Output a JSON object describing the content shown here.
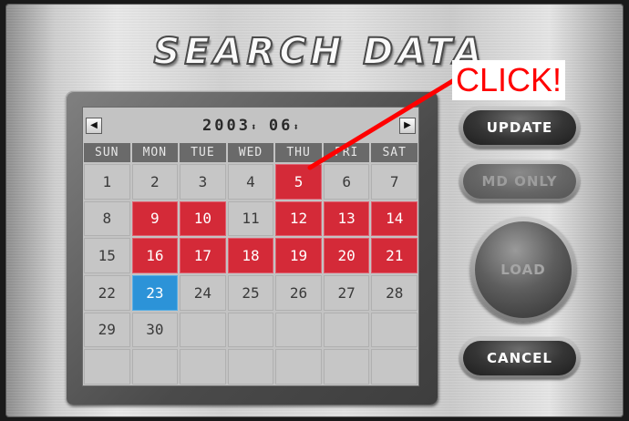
{
  "window": {
    "title": "SEARCH DATA"
  },
  "calendar": {
    "year": "2003",
    "month": "06",
    "spin_glyph": "⬍",
    "prev_glyph": "◀",
    "next_glyph": "▶",
    "weekdays": [
      "SUN",
      "MON",
      "TUE",
      "WED",
      "THU",
      "FRI",
      "SAT"
    ],
    "weeks": [
      [
        {
          "day": "1",
          "state": "normal"
        },
        {
          "day": "2",
          "state": "normal"
        },
        {
          "day": "3",
          "state": "normal"
        },
        {
          "day": "4",
          "state": "normal"
        },
        {
          "day": "5",
          "state": "has-data"
        },
        {
          "day": "6",
          "state": "normal"
        },
        {
          "day": "7",
          "state": "normal"
        }
      ],
      [
        {
          "day": "8",
          "state": "normal"
        },
        {
          "day": "9",
          "state": "has-data"
        },
        {
          "day": "10",
          "state": "has-data"
        },
        {
          "day": "11",
          "state": "normal"
        },
        {
          "day": "12",
          "state": "has-data"
        },
        {
          "day": "13",
          "state": "has-data"
        },
        {
          "day": "14",
          "state": "has-data"
        }
      ],
      [
        {
          "day": "15",
          "state": "normal"
        },
        {
          "day": "16",
          "state": "has-data"
        },
        {
          "day": "17",
          "state": "has-data"
        },
        {
          "day": "18",
          "state": "has-data"
        },
        {
          "day": "19",
          "state": "has-data"
        },
        {
          "day": "20",
          "state": "has-data"
        },
        {
          "day": "21",
          "state": "has-data"
        }
      ],
      [
        {
          "day": "22",
          "state": "normal"
        },
        {
          "day": "23",
          "state": "today"
        },
        {
          "day": "24",
          "state": "normal"
        },
        {
          "day": "25",
          "state": "normal"
        },
        {
          "day": "26",
          "state": "normal"
        },
        {
          "day": "27",
          "state": "normal"
        },
        {
          "day": "28",
          "state": "normal"
        }
      ],
      [
        {
          "day": "29",
          "state": "normal"
        },
        {
          "day": "30",
          "state": "normal"
        },
        {
          "day": "",
          "state": "empty"
        },
        {
          "day": "",
          "state": "empty"
        },
        {
          "day": "",
          "state": "empty"
        },
        {
          "day": "",
          "state": "empty"
        },
        {
          "day": "",
          "state": "empty"
        }
      ],
      [
        {
          "day": "",
          "state": "empty"
        },
        {
          "day": "",
          "state": "empty"
        },
        {
          "day": "",
          "state": "empty"
        },
        {
          "day": "",
          "state": "empty"
        },
        {
          "day": "",
          "state": "empty"
        },
        {
          "day": "",
          "state": "empty"
        },
        {
          "day": "",
          "state": "empty"
        }
      ]
    ]
  },
  "buttons": {
    "update": "UPDATE",
    "md_only": "MD ONLY",
    "load": "LOAD",
    "cancel": "CANCEL"
  },
  "annotation": {
    "label": "CLICK!",
    "color": "#ff0000"
  },
  "colors": {
    "has_data": "#d42a38",
    "today": "#2c93d8",
    "day_cell": "#c6c6c6",
    "weekday_header": "#6a6a6a"
  }
}
